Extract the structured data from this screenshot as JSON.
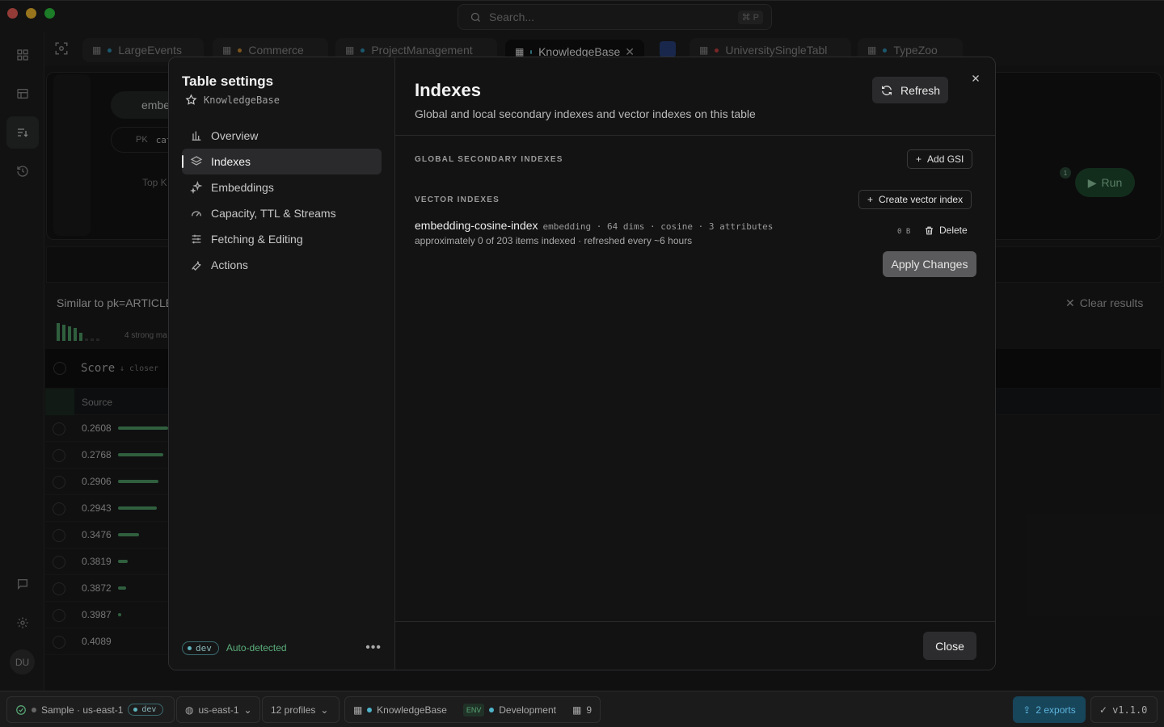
{
  "titlebar": {
    "search_placeholder": "Search...",
    "search_shortcut": "⌘ P"
  },
  "tabs": [
    {
      "label": "LargeEvents",
      "dot": "#2f8fb0"
    },
    {
      "label": "Commerce",
      "dot": "#c98a2e"
    },
    {
      "label": "ProjectManagement",
      "dot": "#2f8fb0"
    },
    {
      "label": "KnowledgeBase",
      "dot": "#4fb3c9",
      "active": true
    },
    {
      "label": "UniversitySingleTabl",
      "dot": "#c53e3e"
    },
    {
      "label": "TypeZoo",
      "dot": "#2f8fb0"
    }
  ],
  "background": {
    "query_chip": "embe",
    "pk_label": "PK",
    "pk_value": "cat",
    "topk_label": "Top K",
    "bookmark_count": "1",
    "run_label": "Run",
    "similar_title": "Similar to pk=ARTICLE",
    "strong_matches": "4 strong ma",
    "clear_results": "Clear results",
    "score_header": "Score",
    "score_hint": "↓ closer",
    "source_header": "Source",
    "results": [
      {
        "score": "0.2608",
        "strength": 1.0
      },
      {
        "score": "0.2768",
        "strength": 0.9
      },
      {
        "score": "0.2906",
        "strength": 0.8
      },
      {
        "score": "0.2943",
        "strength": 0.77
      },
      {
        "score": "0.3476",
        "strength": 0.42
      },
      {
        "score": "0.3819",
        "strength": 0.19
      },
      {
        "score": "0.3872",
        "strength": 0.16
      },
      {
        "score": "0.3987",
        "strength": 0.06
      },
      {
        "score": "0.4089",
        "strength": 0.0
      }
    ]
  },
  "modal": {
    "sidebar": {
      "title": "Table settings",
      "table_name": "KnowledgeBase",
      "items": [
        {
          "label": "Overview",
          "icon": "bar-chart-icon"
        },
        {
          "label": "Indexes",
          "icon": "layers-icon",
          "active": true
        },
        {
          "label": "Embeddings",
          "icon": "sparkle-icon"
        },
        {
          "label": "Capacity, TTL & Streams",
          "icon": "gauge-icon"
        },
        {
          "label": "Fetching & Editing",
          "icon": "sliders-icon"
        },
        {
          "label": "Actions",
          "icon": "wrench-icon"
        }
      ],
      "env_badge": "dev",
      "env_status": "Auto-detected",
      "more_label": "•••"
    },
    "main": {
      "title": "Indexes",
      "description": "Global and local secondary indexes and vector indexes on this table",
      "refresh_label": "Refresh",
      "gsi_section": "GLOBAL SECONDARY INDEXES",
      "add_gsi_label": "Add GSI",
      "vector_section": "VECTOR INDEXES",
      "create_vector_label": "Create vector index",
      "vector_index": {
        "name": "embedding-cosine-index",
        "meta": "embedding · 64 dims · cosine · 3 attributes",
        "status": "approximately 0 of 203 items indexed · refreshed every ~6 hours",
        "size": "0 B",
        "delete_label": "Delete"
      },
      "apply_label": "Apply Changes",
      "close_label": "Close"
    }
  },
  "statusbar": {
    "connection": "Sample · us-east-1",
    "env_badge": "dev",
    "region": "us-east-1",
    "profiles": "12 profiles",
    "table": "KnowledgeBase",
    "env_tag": "ENV",
    "environment": "Development",
    "table_count": "9",
    "exports": "2 exports",
    "version": "v1.1.0"
  },
  "colors": {
    "accent_green": "#4e9a65",
    "run_button": "#1f4a30",
    "export_bg": "#17455a"
  }
}
